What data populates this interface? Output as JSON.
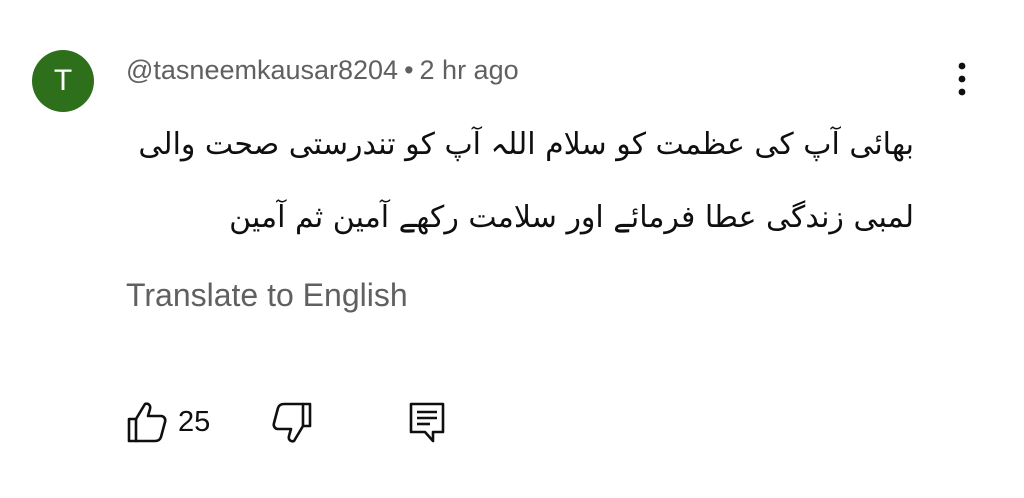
{
  "comment": {
    "avatar_letter": "T",
    "avatar_color": "#2e6f1c",
    "author": "@tasneemkausar8204",
    "separator": "•",
    "timestamp": "2 hr ago",
    "text": "بھائی آپ کی عظمت کو سلام اللہ آپ کو تندرستی صحت والی لمبی زندگی عطا فرمائے اور سلامت رکھے آمین ثم آمین",
    "translate_label": "Translate to English",
    "like_count": "25"
  },
  "icons": {
    "more": "more-vert-icon",
    "like": "thumb-up-icon",
    "dislike": "thumb-down-icon",
    "reply": "comment-reply-icon"
  }
}
